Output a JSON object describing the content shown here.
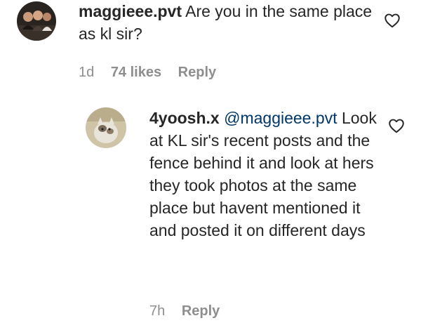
{
  "comments": [
    {
      "username": "maggieee.pvt",
      "text": "Are you in the same place as kl sir?",
      "time": "1d",
      "likes": "74 likes",
      "reply_label": "Reply",
      "avatar_icon": "group-photo-avatar"
    }
  ],
  "replies": [
    {
      "username": "4yoosh.x",
      "mention": "@maggieee.pvt",
      "text": "Look at KL sir's recent posts and the fence behind it and look at hers they took photos at the same place but havent mentioned it and posted it on different days",
      "time": "7h",
      "reply_label": "Reply",
      "avatar_icon": "cat-photo-avatar"
    }
  ],
  "icons": {
    "like": "heart-outline-icon"
  },
  "colors": {
    "text": "#262626",
    "muted": "#8e8e8e",
    "mention": "#00376b"
  }
}
